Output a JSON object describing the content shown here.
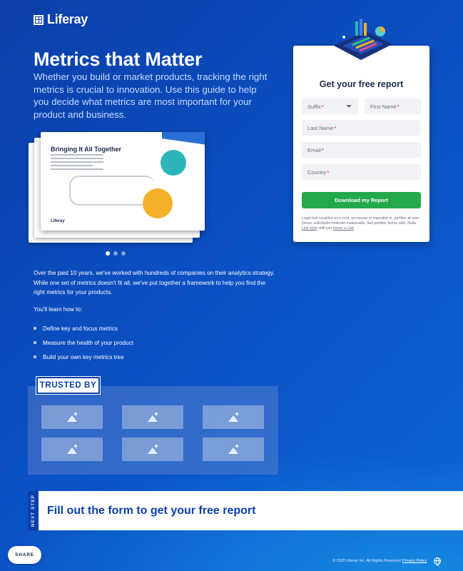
{
  "brand": {
    "name": "Liferay"
  },
  "hero": {
    "title": "Metrics that Matter",
    "intro": "Whether you build or market products, tracking the right metrics is crucial to innovation. Use this guide to help you decide what metrics are most important for your product and business."
  },
  "carousel": {
    "card_title": "Bringing It All Together",
    "card_logo": "Liferay",
    "total_slides": 3,
    "active_slide": 1
  },
  "content": {
    "paragraph": "Over the past 10 years, we've worked with hundreds of companies on their analytics strategy. While one set of metrics doesn't fit all, we've put together a framework to help you find the right metrics for your products.",
    "learn_label": "You'll learn how to:",
    "bullets": [
      "Define key and focus metrics",
      "Measure the health of your product",
      "Build your own key metrics tree"
    ]
  },
  "trusted": {
    "label": "TRUSTED BY"
  },
  "next_step": {
    "tab_label": "NEXT STEP",
    "text": "Fill out the form to get your free report"
  },
  "form": {
    "title": "Get your free report",
    "suffix": "Suffix",
    "first_name": "First Name",
    "last_name": "Last Name",
    "email": "Email",
    "country": "Country",
    "required_mark": "*",
    "submit": "Download my Report",
    "legal_text": "Legal text curabitur arcu erat, accumsan id imperdiet et, porttitor at sem. Donec sollicitudin molestie malesuada. Sed porttitor lectus nibh. Nulla",
    "legal_link1": "Link style",
    "legal_mid": "until you",
    "legal_link2": "Hover a Link",
    "legal_end": "."
  },
  "footer": {
    "share": "SHARE",
    "copyright": "© 2020 Liferay Inc. All Rights Reserved",
    "privacy": "Privacy Policy"
  },
  "colors": {
    "brand_blue": "#0b3fa8",
    "cta_green": "#23a84c",
    "required_red": "#da1414"
  }
}
